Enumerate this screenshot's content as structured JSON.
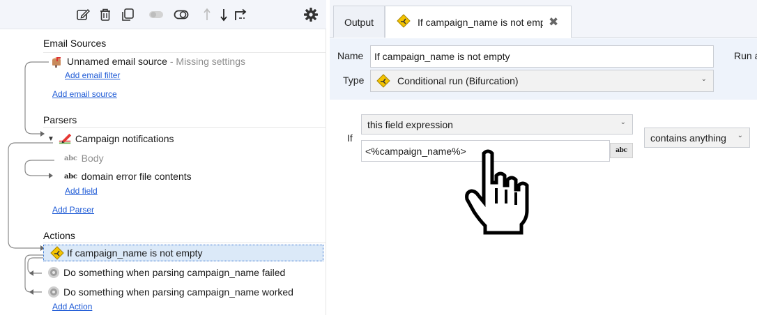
{
  "toolbar": {
    "icons": [
      "edit-icon",
      "delete-icon",
      "copy-icon",
      "toggle-off-icon",
      "toggle-icon",
      "arrow-up-icon",
      "arrow-down-icon",
      "return-arrow-icon",
      "settings-gear-icon"
    ]
  },
  "tree": {
    "email_sources": {
      "heading": "Email Sources",
      "items": [
        {
          "label": "Unnamed email source",
          "suffix": " - Missing settings",
          "icon": "mailbox-icon"
        }
      ],
      "add_filter": "Add email filter",
      "add_source": "Add email source"
    },
    "parsers": {
      "heading": "Parsers",
      "items": [
        {
          "label": "Campaign notifications",
          "icon": "parser-pencil-icon"
        }
      ],
      "fields": [
        {
          "type_label": "abc",
          "label": "Body",
          "muted": true
        },
        {
          "type_label": "abc",
          "label": "domain error file contents",
          "muted": false
        }
      ],
      "add_field": "Add field",
      "add_parser": "Add Parser"
    },
    "actions": {
      "heading": "Actions",
      "items": [
        {
          "label": "If campaign_name is not empty",
          "icon": "bifurcation-icon",
          "selected": true
        },
        {
          "label": "Do something when parsing campaign_name failed",
          "icon": "gear-action-icon"
        },
        {
          "label": "Do something when parsing campaign_name worked",
          "icon": "gear-action-icon"
        }
      ],
      "add_action": "Add Action"
    }
  },
  "tabs": {
    "output": "Output",
    "active": "If campaign_name is not empty",
    "close": "✖"
  },
  "properties": {
    "name_label": "Name",
    "name_value": "If campaign_name is not empty",
    "run_label": "Run a",
    "type_label": "Type",
    "type_value": "Conditional run (Bifurcation)"
  },
  "condition": {
    "if_label": "If",
    "source_select": "this field expression",
    "expression_value": "<%campaign_name%>",
    "expression_type_button": "abc",
    "operator_select": "contains anything"
  },
  "colors": {
    "accent": "#1f5bd6",
    "selection": "#dbe9f8",
    "toolbar_bg": "#f3f5fa",
    "props_bg": "#eef3fb"
  }
}
